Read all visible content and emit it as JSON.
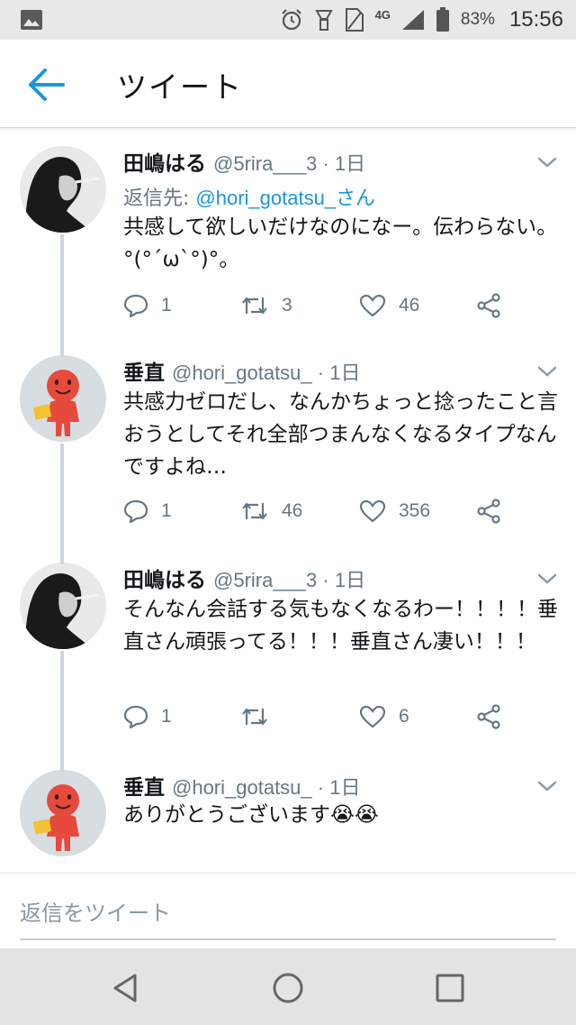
{
  "status_bar": {
    "network": "4G",
    "battery": "83%",
    "time": "15:56"
  },
  "header": {
    "title": "ツイート"
  },
  "tweets": [
    {
      "name": "田嶋はる",
      "handle": "@5rira___3 · 1日",
      "reply_prefix": "返信先: ",
      "reply_to": "@hori_gotatsu_さん",
      "text": "共感して欲しいだけなのになー。伝わらない。°(°´ω`°)°。",
      "replies": "1",
      "retweets": "3",
      "likes": "46",
      "avatar": "face-photo-avatar"
    },
    {
      "name": "垂直",
      "handle": "@hori_gotatsu_ · 1日",
      "text": "共感力ゼロだし、なんかちょっと捻ったこと言おうとしてそれ全部つまんなくなるタイプなんですよね…",
      "replies": "1",
      "retweets": "46",
      "likes": "356",
      "avatar": "red-figure-avatar"
    },
    {
      "name": "田嶋はる",
      "handle": "@5rira___3 · 1日",
      "text": "そんなん会話する気もなくなるわー！！！！垂直さん頑張ってる！！！垂直さん凄い！！！",
      "replies": "1",
      "retweets": "",
      "likes": "6",
      "avatar": "face-photo-avatar"
    },
    {
      "name": "垂直",
      "handle": "@hori_gotatsu_ · 1日",
      "text": "ありがとうございます😭😭",
      "avatar": "red-figure-avatar"
    }
  ],
  "reply_bar": {
    "placeholder": "返信をツイート"
  },
  "colors": {
    "accent": "#1b95e0",
    "muted": "#657786",
    "thread_line": "#cdd6df"
  }
}
